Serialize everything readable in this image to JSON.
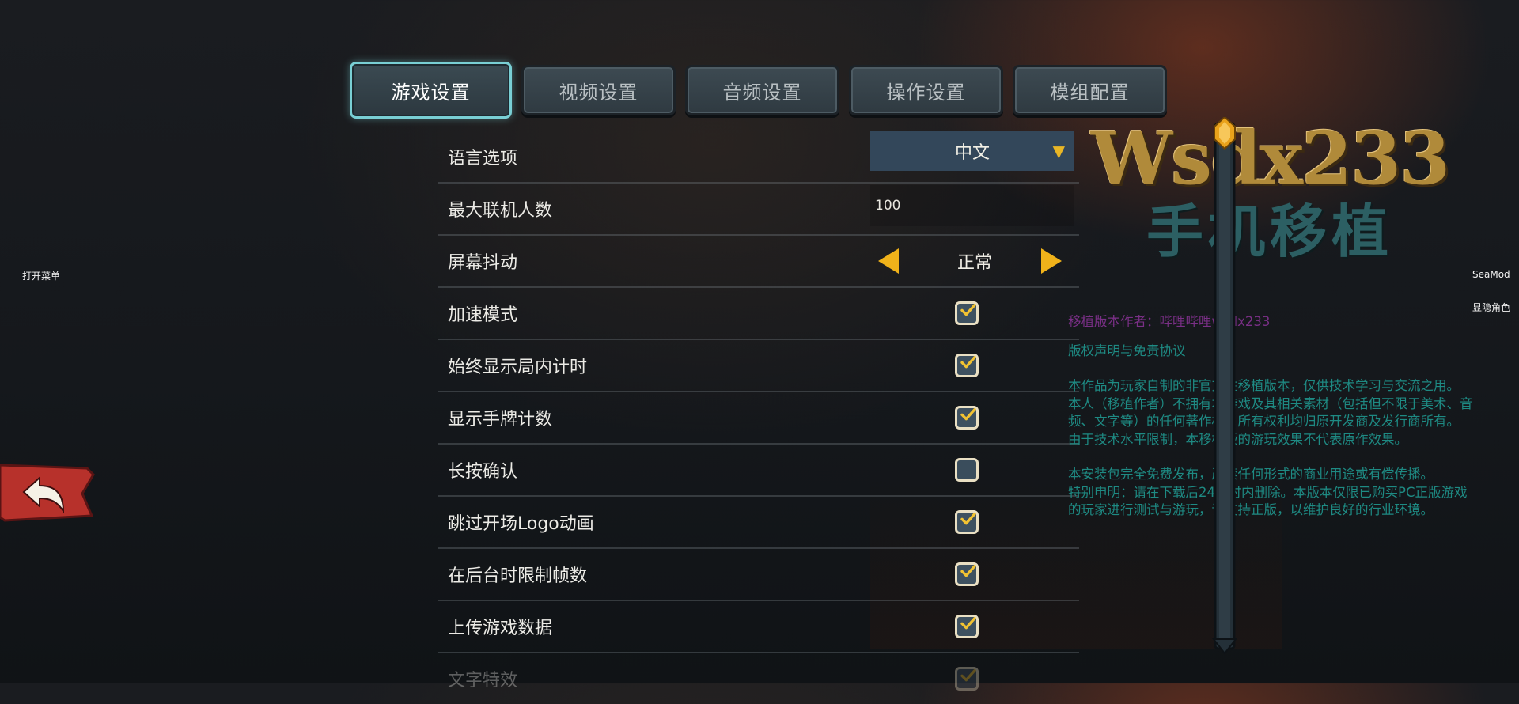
{
  "tabs": [
    {
      "label": "游戏设置",
      "active": true
    },
    {
      "label": "视频设置",
      "active": false
    },
    {
      "label": "音频设置",
      "active": false
    },
    {
      "label": "操作设置",
      "active": false
    },
    {
      "label": "模组配置",
      "active": false
    }
  ],
  "settings": {
    "language": {
      "label": "语言选项",
      "value": "中文"
    },
    "max_players": {
      "label": "最大联机人数",
      "value": "100"
    },
    "screen_shake": {
      "label": "屏幕抖动",
      "value": "正常"
    },
    "fast_mode": {
      "label": "加速模式",
      "checked": true
    },
    "always_show_timer": {
      "label": "始终显示局内计时",
      "checked": true
    },
    "show_hand_count": {
      "label": "显示手牌计数",
      "checked": true
    },
    "long_press_confirm": {
      "label": "长按确认",
      "checked": false
    },
    "skip_logo": {
      "label": "跳过开场Logo动画",
      "checked": true
    },
    "limit_fps_background": {
      "label": "在后台时限制帧数",
      "checked": true
    },
    "upload_data": {
      "label": "上传游戏数据",
      "checked": true
    },
    "text_effects": {
      "label": "文字特效",
      "checked": true
    }
  },
  "side": {
    "open_menu": "打开菜单",
    "seamod": "SeaMod",
    "toggle_character": "显隐角色"
  },
  "logo": {
    "main": "Wsdx233",
    "sub": "手机移植"
  },
  "disclaimer": {
    "author": "移植版本作者：哔哩哔哩wsdx233",
    "heading": "版权声明与免责协议",
    "p1": "本作品为玩家自制的非官方性移植版本，仅供技术学习与交流之用。",
    "p2": "本人（移植作者）不拥有本游戏及其相关素材（包括但不限于美术、音频、文字等）的任何著作权。所有权利均归原开发商及发行商所有。",
    "p3": "由于技术水平限制，本移植版的游玩效果不代表原作效果。",
    "p4": "本安装包完全免费发布，严禁任何形式的商业用途或有偿传播。",
    "p5": "特别申明：请在下载后24小时内删除。本版本仅限已购买PC正版游戏的玩家进行测试与游玩，请支持正版，以维护良好的行业环境。"
  },
  "colors": {
    "accent": "#79cfd4",
    "gold": "#f0b21a",
    "disclaimer": "#1e8a83",
    "back_button": "#b7312b"
  }
}
